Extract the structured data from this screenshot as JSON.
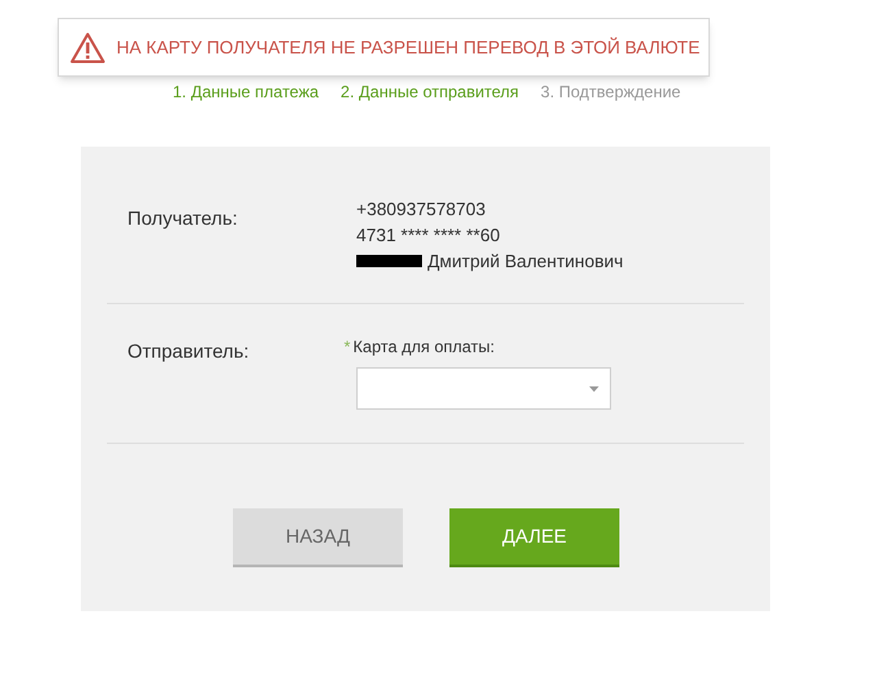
{
  "alert": {
    "message": "НА КАРТУ ПОЛУЧАТЕЛЯ НЕ РАЗРЕШЕН ПЕРЕВОД В ЭТОЙ ВАЛЮТЕ"
  },
  "steps": [
    {
      "label": "1. Данные платежа",
      "done": true
    },
    {
      "label": "2. Данные отправителя",
      "done": true
    },
    {
      "label": "3. Подтверждение",
      "done": false
    }
  ],
  "recipient": {
    "label": "Получатель:",
    "phone": "+380937578703",
    "card": "4731 **** **** **60",
    "name": "Дмитрий Валентинович",
    "surname_redacted": true
  },
  "sender": {
    "label": "Отправитель:",
    "field_label": "Карта для оплаты:",
    "required_mark": "*"
  },
  "buttons": [
    {
      "label": "НАЗАД",
      "kind": "secondary"
    },
    {
      "label": "ДАЛЕЕ",
      "kind": "primary"
    }
  ]
}
